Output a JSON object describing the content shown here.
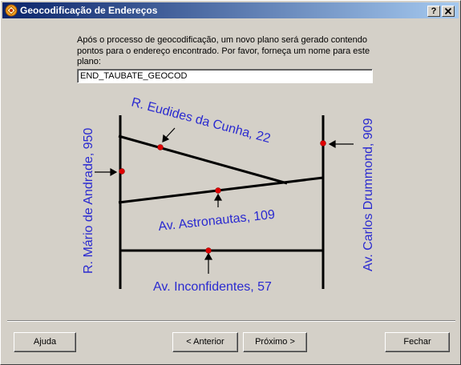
{
  "window": {
    "title": "Geocodificação de Endereços",
    "help_button": "?",
    "close_button": "X"
  },
  "instructions": "Após o processo de geocodificação, um novo plano será gerado contendo pontos para o endereço encontrado. Por favor, forneça um nome para este plano:",
  "plane_name": {
    "value": "END_TAUBATE_GEOCOD"
  },
  "diagram": {
    "labels": {
      "street_left": "R. Mário de Andrade, 950",
      "street_top": "R. Eudides da Cunha, 22",
      "street_right": "Av. Carlos Drummond, 909",
      "street_middle": "Av. Astronautas, 109",
      "street_bottom": "Av. Inconfidentes, 57"
    },
    "colors": {
      "label": "#2a2ad0",
      "point": "#e00000",
      "line": "#000000"
    }
  },
  "buttons": {
    "help": "Ajuda",
    "back": "< Anterior",
    "next": "Próximo >",
    "close": "Fechar"
  }
}
